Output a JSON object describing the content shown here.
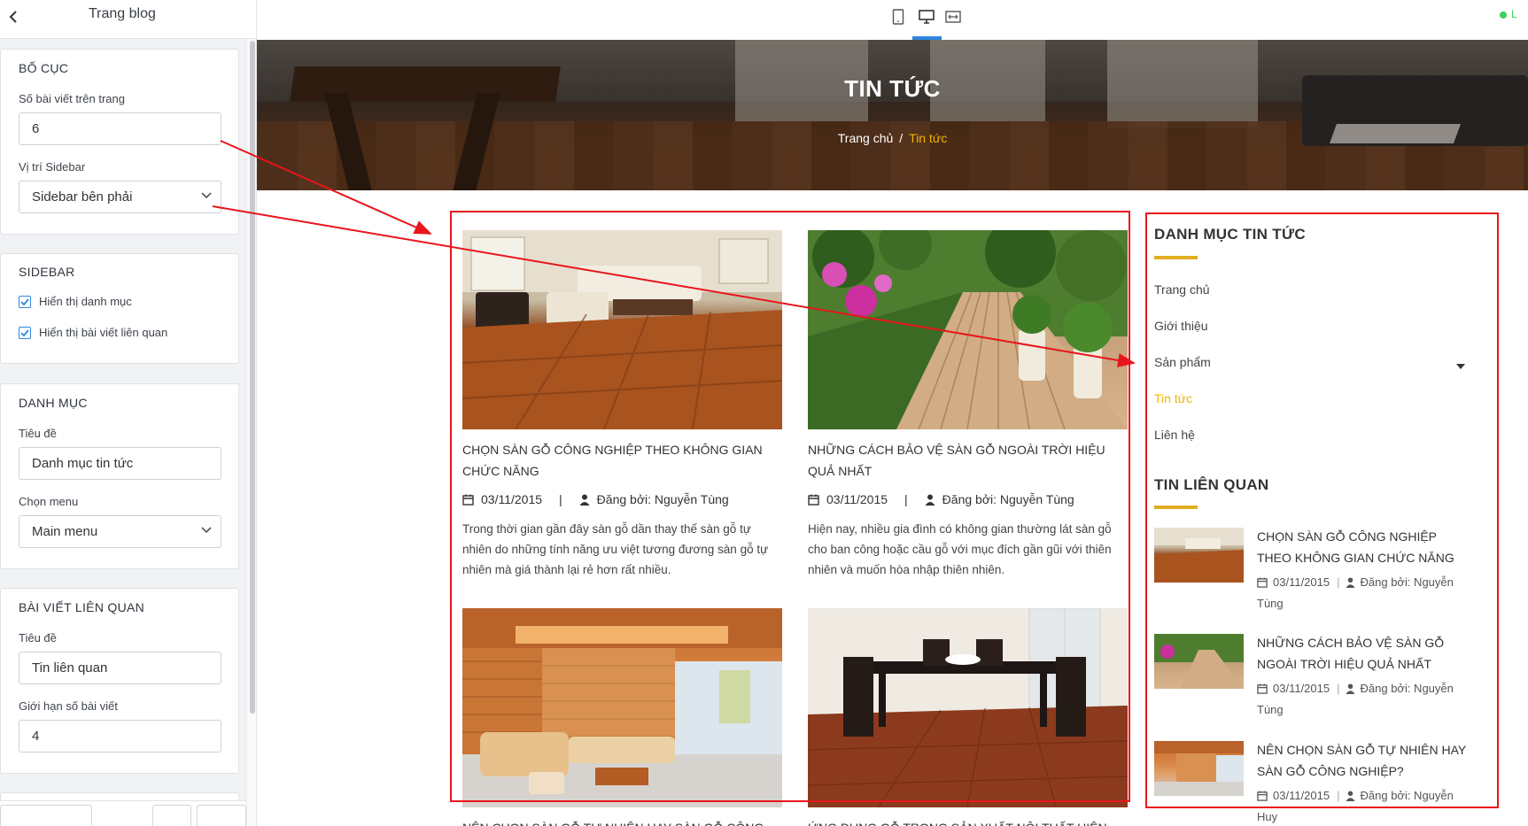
{
  "panel": {
    "title": "Trang blog",
    "layout": {
      "heading": "BỐ CỤC",
      "posts_per_page_label": "Số bài viết trên trang",
      "posts_per_page_value": "6",
      "sidebar_position_label": "Vị trí Sidebar",
      "sidebar_position_value": "Sidebar bên phải"
    },
    "sidebar": {
      "heading": "SIDEBAR",
      "show_categories_label": "Hiển thị danh mục",
      "show_categories_checked": true,
      "show_related_label": "Hiển thị bài viết liên quan",
      "show_related_checked": true
    },
    "category": {
      "heading": "DANH MỤC",
      "title_label": "Tiêu đề",
      "title_value": "Danh mục tin tức",
      "menu_label": "Chọn menu",
      "menu_value": "Main menu"
    },
    "related": {
      "heading": "BÀI VIẾT LIÊN QUAN",
      "title_label": "Tiêu đề",
      "title_value": "Tin liên quan",
      "limit_label": "Giới hạn số bài viết",
      "limit_value": "4"
    }
  },
  "topbar": {
    "devices": [
      "mobile-icon",
      "desktop-icon",
      "fullwidth-icon"
    ],
    "active_device": "desktop-icon",
    "status_letter": "L",
    "accent_color": "#2e86de"
  },
  "hero": {
    "title": "TIN TỨC",
    "crumb_home": "Trang chủ",
    "crumb_sep": "/",
    "crumb_current": "Tin tức",
    "crumb_active_color": "#f5b400"
  },
  "posts": [
    {
      "title": "CHỌN SÀN GỖ CÔNG NGHIỆP THEO KHÔNG GIAN CHỨC NĂNG",
      "date": "03/11/2015",
      "author": "Đăng bởi: Nguyễn Tùng",
      "excerpt": "Trong thời gian gần đây sàn gỗ dần thay thế sàn gỗ tự nhiên do những tính năng ưu việt tương đương sàn gỗ tự nhiên mà giá thành lại rẻ hơn rất nhiều."
    },
    {
      "title": "NHỮNG CÁCH BẢO VỆ SÀN GỖ NGOÀI TRỜI HIỆU QUẢ NHẤT",
      "date": "03/11/2015",
      "author": "Đăng bởi: Nguyễn Tùng",
      "excerpt": "Hiện nay, nhiều gia đình có không gian thường lát sàn gỗ cho ban công hoặc cầu gỗ với mục đích gần gũi với thiên nhiên và muốn hòa nhập thiên nhiên."
    },
    {
      "title": "NÊN CHỌN SÀN GỖ TỰ NHIÊN HAY SÀN GỖ CÔNG",
      "date": "",
      "author": "",
      "excerpt": ""
    },
    {
      "title": "ỨNG DỤNG GỖ TRONG SẢN XUẤT NỘI THẤT HIỆN",
      "date": "",
      "author": "",
      "excerpt": ""
    }
  ],
  "sidebar": {
    "category_heading": "DANH MỤC TIN TỨC",
    "menu": [
      "Trang chủ",
      "Giới thiệu",
      "Sản phẩm",
      "Tin tức",
      "Liên hệ"
    ],
    "active_menu": "Tin tức",
    "related_heading": "TIN LIÊN QUAN",
    "related": [
      {
        "title": "CHỌN SÀN GỖ CÔNG NGHIỆP THEO KHÔNG GIAN CHỨC NĂNG",
        "date": "03/11/2015",
        "author": "Đăng bởi: Nguyễn Tùng"
      },
      {
        "title": "NHỮNG CÁCH BẢO VỆ SÀN GỖ NGOÀI TRỜI HIỆU QUẢ NHẤT",
        "date": "03/11/2015",
        "author": "Đăng bởi: Nguyễn Tùng"
      },
      {
        "title": "NÊN CHỌN SÀN GỖ TỰ NHIÊN HAY SÀN GỖ CÔNG NGHIỆP?",
        "date": "03/11/2015",
        "author": "Đăng bởi: Nguyễn Huy"
      }
    ],
    "underline_color": "#e2ad1f"
  },
  "annotation_color": "#e8151c"
}
